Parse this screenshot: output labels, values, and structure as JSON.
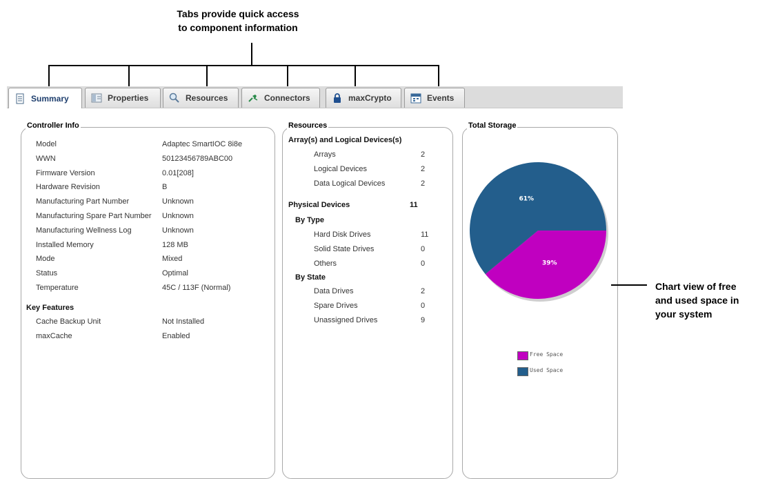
{
  "annotations": {
    "tabs_line1": "Tabs provide quick access",
    "tabs_line2": "to component information",
    "chart_line1": "Chart view of free",
    "chart_line2": "and used space in",
    "chart_line3": "your system"
  },
  "tabs": [
    {
      "label": "Summary",
      "icon": "document-icon",
      "active": true
    },
    {
      "label": "Properties",
      "icon": "properties-icon",
      "active": false
    },
    {
      "label": "Resources",
      "icon": "magnifier-icon",
      "active": false
    },
    {
      "label": "Connectors",
      "icon": "connector-icon",
      "active": false
    },
    {
      "label": "maxCrypto",
      "icon": "lock-icon",
      "active": false
    },
    {
      "label": "Events",
      "icon": "calendar-icon",
      "active": false
    }
  ],
  "controller": {
    "title": "Controller Info",
    "rows": [
      {
        "label": "Model",
        "value": "Adaptec SmartIOC 8i8e"
      },
      {
        "label": "WWN",
        "value": "50123456789ABC00"
      },
      {
        "label": "Firmware Version",
        "value": "0.01[208]"
      },
      {
        "label": "Hardware Revision",
        "value": "B"
      },
      {
        "label": "Manufacturing Part Number",
        "value": "Unknown"
      },
      {
        "label": "Manufacturing Spare Part Number",
        "value": "Unknown"
      },
      {
        "label": "Manufacturing Wellness Log",
        "value": "Unknown"
      },
      {
        "label": "Installed Memory",
        "value": "128 MB"
      },
      {
        "label": "Mode",
        "value": "Mixed"
      },
      {
        "label": "Status",
        "value": "Optimal"
      },
      {
        "label": "Temperature",
        "value": "45C / 113F (Normal)"
      }
    ],
    "features_title": "Key Features",
    "features": [
      {
        "label": "Cache Backup Unit",
        "value": "Not Installed"
      },
      {
        "label": "maxCache",
        "value": "Enabled"
      }
    ]
  },
  "resources": {
    "title": "Resources",
    "arrays_header": "Array(s) and Logical Devices(s)",
    "arrays": [
      {
        "label": "Arrays",
        "value": "2"
      },
      {
        "label": "Logical Devices",
        "value": "2"
      },
      {
        "label": "Data Logical Devices",
        "value": "2"
      }
    ],
    "physical_header": "Physical Devices",
    "physical_total": "11",
    "by_type_header": "By Type",
    "by_type": [
      {
        "label": "Hard Disk Drives",
        "value": "11"
      },
      {
        "label": "Solid State Drives",
        "value": "0"
      },
      {
        "label": "Others",
        "value": "0"
      }
    ],
    "by_state_header": "By State",
    "by_state": [
      {
        "label": "Data Drives",
        "value": "2"
      },
      {
        "label": "Spare Drives",
        "value": "0"
      },
      {
        "label": "Unassigned Drives",
        "value": "9"
      }
    ]
  },
  "storage": {
    "title": "Total Storage",
    "legend_free": "Free Space",
    "legend_used": "Used Space",
    "free_color": "#c000c0",
    "used_color": "#235e8c"
  },
  "chart_data": {
    "type": "pie",
    "categories": [
      "Free Space",
      "Used Space"
    ],
    "values": [
      39,
      61
    ],
    "labels": [
      "39%",
      "61%"
    ],
    "colors": [
      "#c000c0",
      "#235e8c"
    ]
  }
}
